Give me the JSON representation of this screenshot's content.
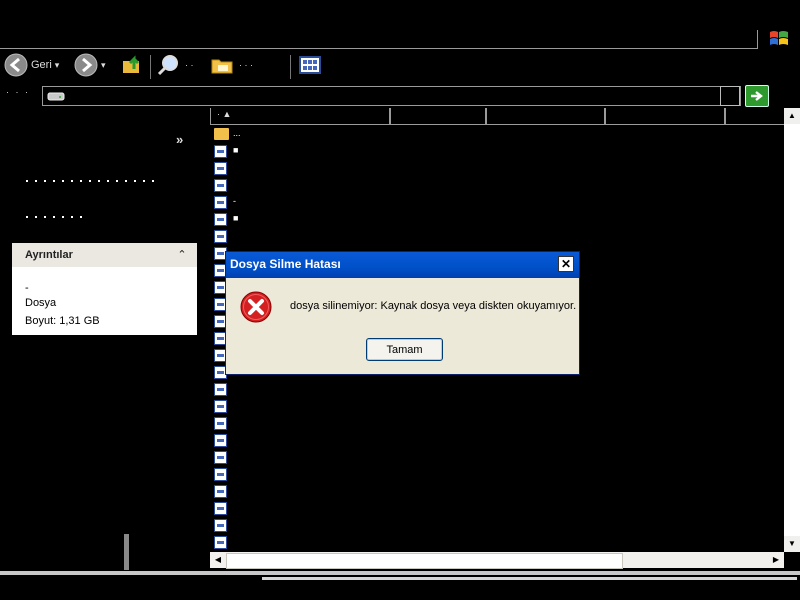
{
  "toolbar": {
    "back_label": "Geri"
  },
  "details_panel": {
    "title": "Ayrıntılar",
    "name": "-",
    "type": "Dosya",
    "size": "Boyut: 1,31 GB"
  },
  "dialog": {
    "title": "Dosya Silme Hatası",
    "message": "dosya silinemiyor: Kaynak dosya veya diskten okuyamıyor.",
    "ok_label": "Tamam",
    "close_glyph": "✕"
  },
  "file_rows": [
    {
      "icon": "folder-icon",
      "name": "..."
    },
    {
      "icon": "file-icon",
      "name": "■"
    },
    {
      "icon": "file-icon",
      "name": ""
    },
    {
      "icon": "file-icon",
      "name": ""
    },
    {
      "icon": "file-icon",
      "name": "-"
    },
    {
      "icon": "file-icon",
      "name": "■"
    },
    {
      "icon": "file-icon",
      "name": ""
    },
    {
      "icon": "file-icon",
      "name": ""
    },
    {
      "icon": "file-icon",
      "name": ""
    },
    {
      "icon": "file-icon",
      "name": ""
    },
    {
      "icon": "file-icon",
      "name": ""
    },
    {
      "icon": "file-icon",
      "name": ""
    },
    {
      "icon": "file-icon",
      "name": ""
    },
    {
      "icon": "file-icon",
      "name": ""
    },
    {
      "icon": "file-icon",
      "name": ""
    },
    {
      "icon": "file-icon",
      "name": ""
    },
    {
      "icon": "file-icon",
      "name": ""
    },
    {
      "icon": "file-icon",
      "name": ""
    },
    {
      "icon": "file-icon",
      "name": ""
    },
    {
      "icon": "file-icon",
      "name": ""
    },
    {
      "icon": "file-icon",
      "name": ""
    },
    {
      "icon": "file-icon",
      "name": ""
    },
    {
      "icon": "file-icon",
      "name": ""
    },
    {
      "icon": "file-icon",
      "name": ""
    },
    {
      "icon": "file-icon",
      "name": ""
    }
  ],
  "colors": {
    "dialog_titlebar": "#0050c8",
    "dialog_bg": "#ece9d8",
    "error_red": "#d42020",
    "go_green": "#2e9a2e"
  }
}
